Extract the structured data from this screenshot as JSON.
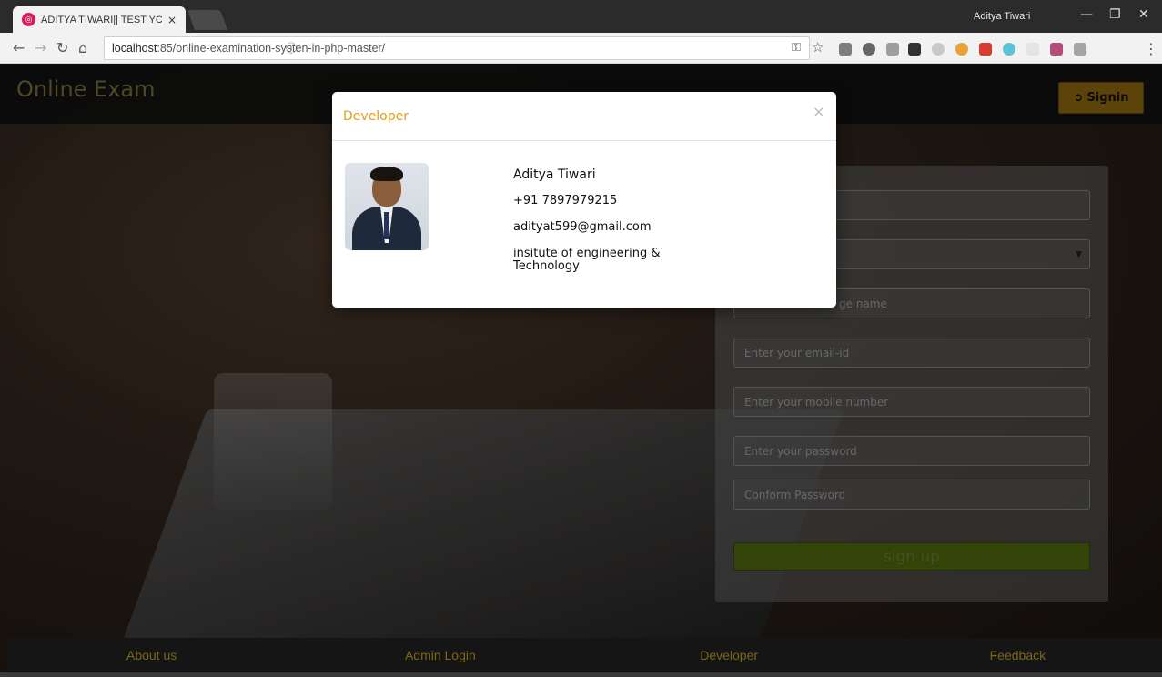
{
  "browser": {
    "tab_title": "ADITYA TIWARI|| TEST YC",
    "tab_close": "×",
    "profile_name": "Aditya Tiwari",
    "url_host": "localhost",
    "url_rest": ":85/online-examination-systen-in-php-master/",
    "window_controls": {
      "minimize": "—",
      "restore": "❐",
      "close": "✕"
    }
  },
  "site": {
    "logo": "Online Exam",
    "signin_label": "Signin"
  },
  "modal": {
    "title": "Developer",
    "close": "×",
    "name": "Aditya Tiwari",
    "phone": "+91 7897979215",
    "email": "adityat599@gmail.com",
    "institute_line1": "insitute of engineering &",
    "institute_line2": "Technology"
  },
  "signup_form": {
    "fields": [
      {
        "placeholder": ""
      },
      {
        "placeholder": ""
      },
      {
        "placeholder": "ge name"
      },
      {
        "placeholder": "Enter your email-id"
      },
      {
        "placeholder": "Enter your mobile number"
      },
      {
        "placeholder": "Enter your password"
      },
      {
        "placeholder": "Conform Password"
      }
    ],
    "submit_label": "sign up"
  },
  "footer": {
    "links": [
      "About us",
      "Admin Login",
      "Developer",
      "Feedback"
    ]
  },
  "colors": {
    "accent": "#e39e18",
    "signin_bg": "#a87a12",
    "signup_bg": "#5b7d10",
    "footer_link": "#7d6713"
  }
}
